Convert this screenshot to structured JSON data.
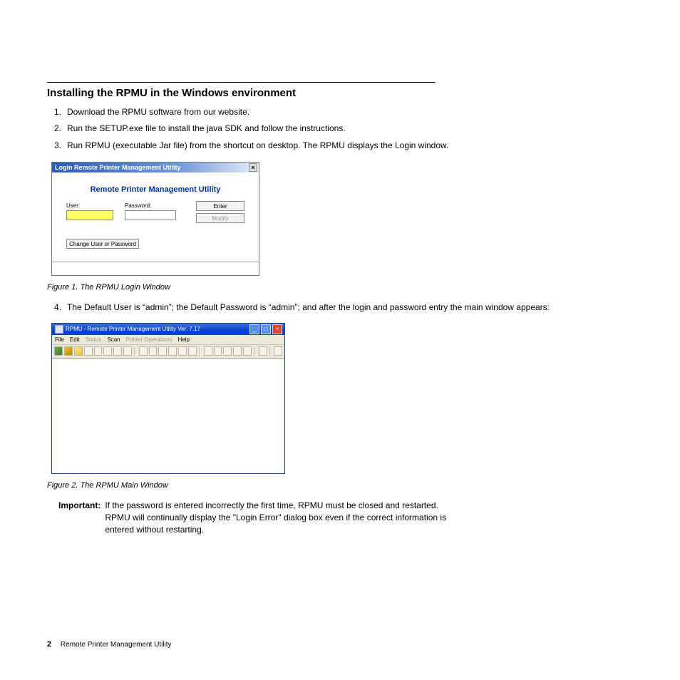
{
  "section_title": "Installing the RPMU in the Windows environment",
  "steps_first": [
    "Download the RPMU software from our website.",
    "Run the SETUP.exe file to install the java SDK and follow the instructions.",
    "Run RPMU (executable Jar file) from the shortcut on desktop. The RPMU displays the Login window."
  ],
  "login": {
    "titlebar": "Login Remote Printer Management Utility",
    "heading": "Remote Printer Management Utility",
    "user_label": "User:",
    "password_label": "Password:",
    "enter_btn": "Enter",
    "modify_btn": "Modify",
    "change_btn": "Change User or Password"
  },
  "caption1": "Figure 1. The RPMU Login Window",
  "step4": "The Default User is “admin”; the Default Password is “admin”; and after the login and password entry the main window appears:",
  "mainwin": {
    "title": "RPMU - Remote Printer Management Utility Ver. 7.17",
    "menus": {
      "file": "File",
      "edit": "Edit",
      "status": "Status",
      "scan": "Scan",
      "printer_ops": "Printer Operations",
      "help": "Help"
    }
  },
  "caption2": "Figure 2. The RPMU Main Window",
  "important": {
    "label": "Important:",
    "text": "If the password is entered incorrectly the first time, RPMU must be closed and restarted. RPMU will continually display the \"Login Error\" dialog box even if the correct information is entered without restarting."
  },
  "footer": {
    "page_num": "2",
    "doc_title": "Remote Printer Management Utility"
  }
}
